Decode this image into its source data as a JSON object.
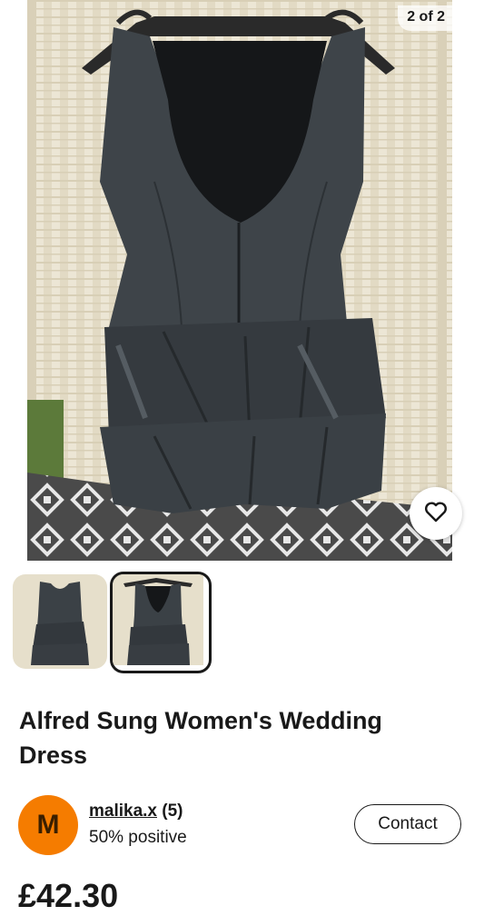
{
  "gallery": {
    "counter": "2 of 2",
    "main_image_alt": "Black sleeveless tiered peplum dress on a hanger, back view",
    "thumbnails": [
      {
        "alt": "Dress front view",
        "selected": false
      },
      {
        "alt": "Dress back view",
        "selected": true
      }
    ],
    "favorite_icon": "heart-outline-icon"
  },
  "listing": {
    "title": "Alfred Sung Women's Wedding Dress",
    "price": "£42.30"
  },
  "seller": {
    "avatar_initial": "M",
    "avatar_color": "#f57c00",
    "name": "malika.x",
    "feedback_count": "(5)",
    "positive": "50% positive"
  },
  "actions": {
    "contact_label": "Contact"
  }
}
